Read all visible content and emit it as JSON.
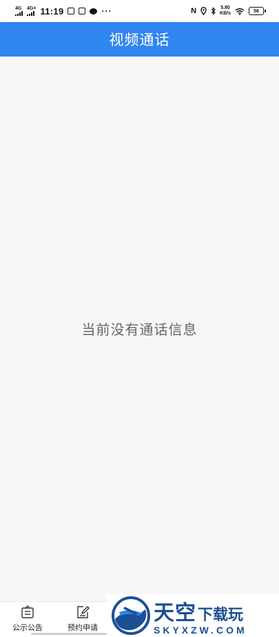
{
  "status_bar": {
    "sim1_network": "4G",
    "sim2_network": "4G+",
    "time": "11:19",
    "more": "···",
    "nfc": "N",
    "speed_value": "5.80",
    "speed_unit": "KB/s",
    "battery": "56"
  },
  "header": {
    "title": "视频通话"
  },
  "main": {
    "empty_message": "当前没有通话信息"
  },
  "bottom_nav": {
    "items": [
      {
        "label": "公示公告",
        "icon": "notice-board-icon"
      },
      {
        "label": "预约申请",
        "icon": "edit-form-icon"
      }
    ]
  },
  "watermark": {
    "cn_big": "天空",
    "cn_small": "下载玩",
    "en": "SKYXZW.COM",
    "colors": {
      "brand": "#1b4f94"
    }
  },
  "colors": {
    "header_bg": "#2f86ef",
    "page_bg": "#f7f7f7"
  }
}
